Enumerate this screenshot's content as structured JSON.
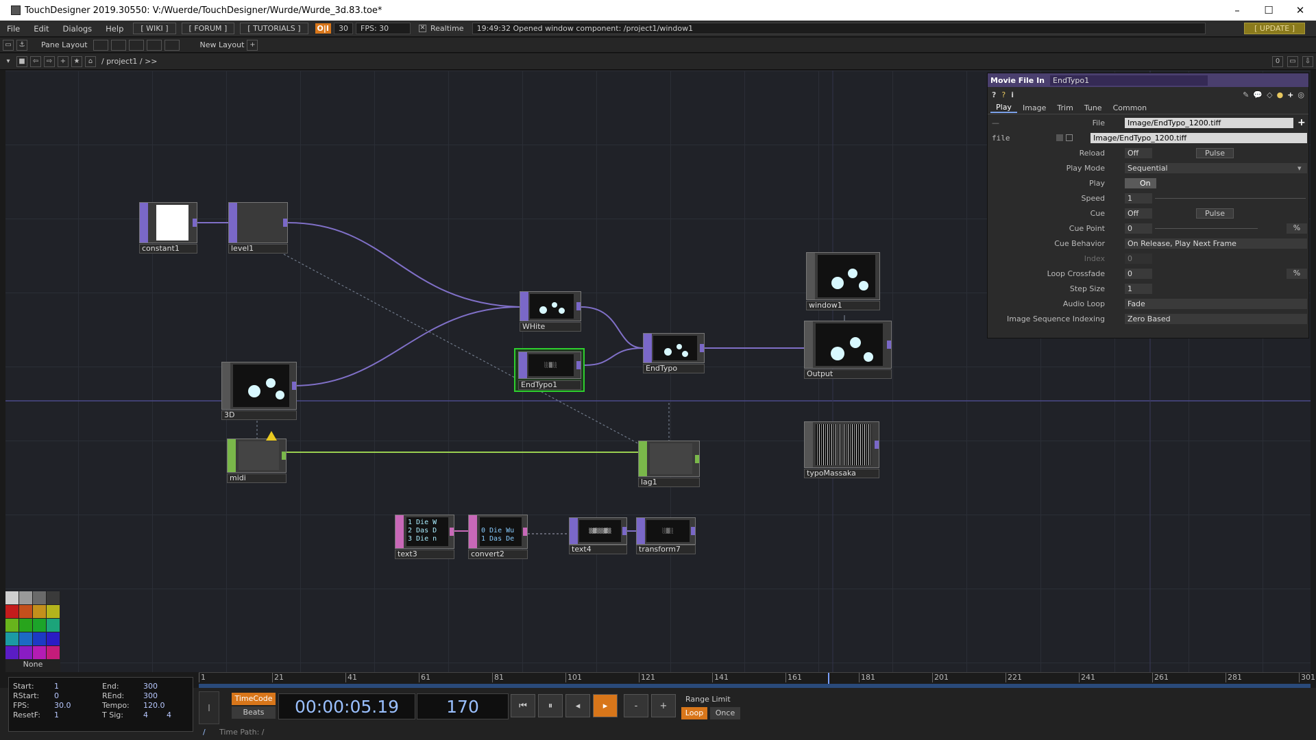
{
  "window": {
    "title": "TouchDesigner 2019.30550: V:/Wuerde/TouchDesigner/Wurde/Wurde_3d.83.toe*",
    "minimize": "–",
    "maximize": "☐",
    "close": "✕"
  },
  "menu": {
    "items": [
      "File",
      "Edit",
      "Dialogs",
      "Help"
    ],
    "wiki": "[ WIKI ]",
    "forum": "[ FORUM ]",
    "tutorials": "[ TUTORIALS ]",
    "oi": "O|I",
    "fps_target": "30",
    "fps": "FPS:  30",
    "realtime": "Realtime",
    "status": "19:49:32 Opened window component: /project1/window1",
    "update": "[ UPDATE ]"
  },
  "toolbar": {
    "pane_layout": "Pane Layout",
    "new_layout": "New Layout",
    "add": "+",
    "path": "/ project1 / >>",
    "zero": "0"
  },
  "nodes": {
    "constant1": "constant1",
    "level1": "level1",
    "white": "WHite",
    "endtypo1": "EndTypo1",
    "endtypo": "EndTypo",
    "window1": "window1",
    "output": "Output",
    "threed": "3D",
    "midi": "midi",
    "lag1": "lag1",
    "typomassaka": "typoMassaka",
    "text3": "text3",
    "convert2": "convert2",
    "text4": "text4",
    "transform7": "transform7",
    "text3_preview": [
      "1  Die W",
      "2  Das D",
      "3  Die n"
    ],
    "convert2_preview": [
      "0  Die Wu",
      "1  Das De"
    ]
  },
  "params": {
    "op_type": "Movie File In",
    "op_name": "EndTypo1",
    "tabs": [
      "Play",
      "Image",
      "Trim",
      "Tune",
      "Common"
    ],
    "file_label": "File",
    "file_value": "Image/EndTypo_1200.tiff",
    "file_sub_label": "file",
    "file_sub_value": "Image/EndTypo_1200.tiff",
    "reload_label": "Reload",
    "reload_value": "Off",
    "pulse": "Pulse",
    "playmode_label": "Play Mode",
    "playmode_value": "Sequential",
    "play_label": "Play",
    "play_value": "On",
    "speed_label": "Speed",
    "speed_value": "1",
    "cue_label": "Cue",
    "cue_value": "Off",
    "cuepoint_label": "Cue Point",
    "cuepoint_value": "0",
    "cuepoint_unit": "%",
    "cuebehavior_label": "Cue Behavior",
    "cuebehavior_value": "On Release, Play Next Frame",
    "index_label": "Index",
    "index_value": "0",
    "loopcrossfade_label": "Loop Crossfade",
    "loopcrossfade_value": "0",
    "loopcrossfade_unit": "%",
    "stepsize_label": "Step Size",
    "stepsize_value": "1",
    "audioloop_label": "Audio Loop",
    "audioloop_value": "Fade",
    "imgseq_label": "Image Sequence Indexing",
    "imgseq_value": "Zero Based"
  },
  "palette": {
    "none_label": "None",
    "colors": [
      "#cfcfcf",
      "#9a9a9a",
      "#6a6a6a",
      "#3a3a3a",
      "#c41c1c",
      "#c4501c",
      "#c4901c",
      "#b4b41c",
      "#68b41c",
      "#28a41c",
      "#1ca42a",
      "#1ca47a",
      "#1c9aa4",
      "#1c6ac4",
      "#1c3ac4",
      "#2a1cc4",
      "#5a1cc4",
      "#8a1cc4",
      "#b41cb4",
      "#c41c7a"
    ]
  },
  "timeline": {
    "ticks": [
      "1",
      "21",
      "41",
      "61",
      "81",
      "101",
      "121",
      "141",
      "161",
      "181",
      "201",
      "221",
      "241",
      "261",
      "281",
      "301"
    ]
  },
  "stats": {
    "start_label": "Start:",
    "start": "1",
    "end_label": "End:",
    "end": "300",
    "rstart_label": "RStart:",
    "rstart": "0",
    "rend_label": "REnd:",
    "rend": "300",
    "fps_label": "FPS:",
    "fps": "30.0",
    "tempo_label": "Tempo:",
    "tempo": "120.0",
    "resetf_label": "ResetF:",
    "resetf": "1",
    "tsig_label": "T Sig:",
    "tsig_a": "4",
    "tsig_b": "4"
  },
  "transport": {
    "timecode_btn": "TimeCode",
    "beats_btn": "Beats",
    "timecode": "00:00:05.19",
    "frame": "170",
    "minus": "-",
    "plus": "+",
    "range_limit": "Range Limit",
    "loop": "Loop",
    "once": "Once",
    "time_path": "Time Path: /",
    "slash": "/"
  },
  "colors": {
    "top": "#7a68c8",
    "chop": "#7ab84a",
    "dat": "#c868b8",
    "selected": "#2ed02e",
    "wire_top": "#8070c8",
    "wire_chop": "#9ad050"
  }
}
